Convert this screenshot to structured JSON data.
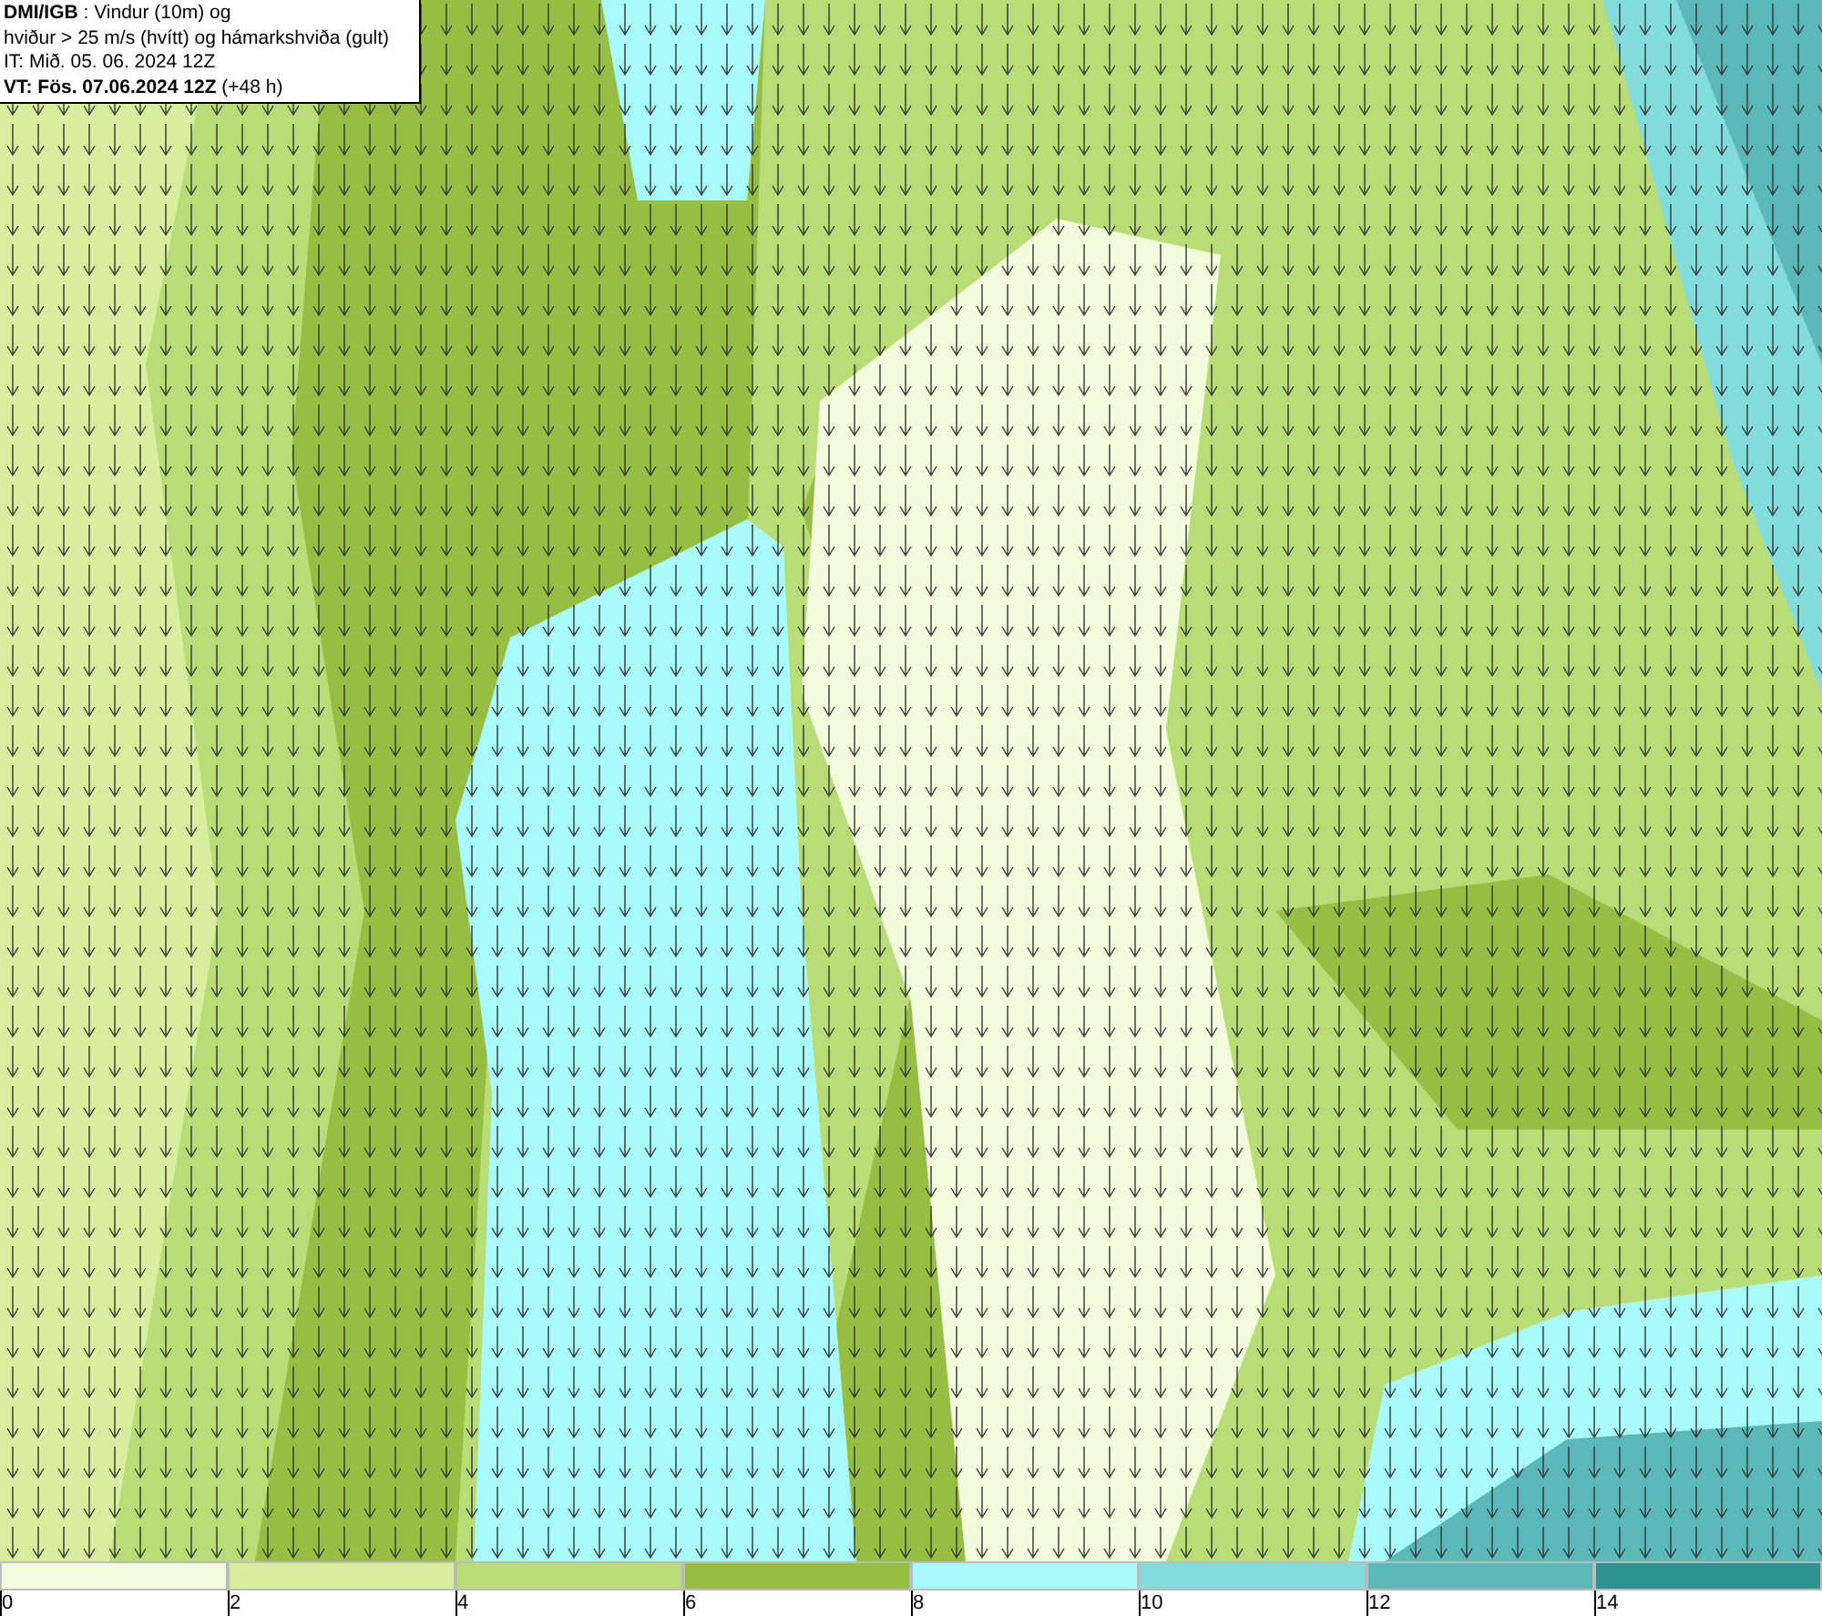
{
  "header": {
    "lines": [
      "**DMI/IGB** : Vindur (10m) og",
      "hviður > 25 m/s (hvítt) og hámarkshviða (gult)",
      "IT: Mið. 05. 06. 2024 12Z",
      "**VT: Fös. 07.06.2024 12Z** (+48 h)"
    ]
  },
  "legend": [
    {
      "label": "0",
      "color": "#f2fbdc"
    },
    {
      "label": "2",
      "color": "#d6ee9e"
    },
    {
      "label": "4",
      "color": "#b8dc76"
    },
    {
      "label": "6",
      "color": "#96be42"
    },
    {
      "label": "8",
      "color": "#a8fafa"
    },
    {
      "label": "10",
      "color": "#82dcdc"
    },
    {
      "label": "12",
      "color": "#5ab8b8"
    },
    {
      "label": "14",
      "color": "#2c9290"
    }
  ]
}
